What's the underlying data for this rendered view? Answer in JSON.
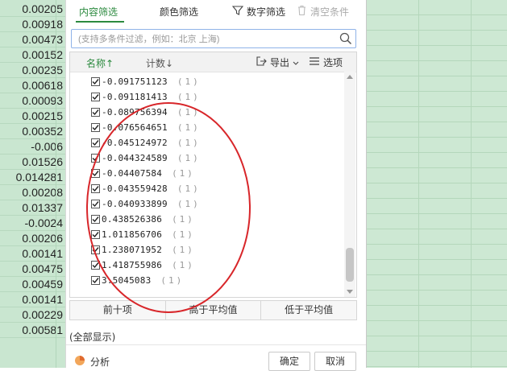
{
  "sheet": {
    "left_cells": [
      "0.00205",
      "0.00918",
      "0.00473",
      "0.00152",
      "0.00235",
      "0.00618",
      "0.00093",
      "0.00215",
      "0.00352",
      "-0.006",
      "0.01526",
      "0.014281",
      "0.00208",
      "0.01337",
      "-0.0024",
      "0.00206",
      "0.00141",
      "0.00475",
      "0.00459",
      "0.00141",
      "0.00229",
      "0.00581"
    ]
  },
  "panel": {
    "tabs": [
      "内容筛选",
      "颜色筛选"
    ],
    "number_filter_label": "数字筛选",
    "clear_label": "清空条件",
    "search_placeholder": "(支持多条件过滤，例如：北京 上海)",
    "header": {
      "sort_name": "名称↑",
      "sort_count": "计数↓",
      "export": "导出",
      "options": "选项"
    },
    "items": [
      {
        "value": "-0.091751123",
        "count": "(1)",
        "checked": true
      },
      {
        "value": "-0.091181413",
        "count": "(1)",
        "checked": true
      },
      {
        "value": "-0.089756394",
        "count": "(1)",
        "checked": true
      },
      {
        "value": "-0.076564651",
        "count": "(1)",
        "checked": true
      },
      {
        "value": "-0.045124972",
        "count": "(1)",
        "checked": true
      },
      {
        "value": "-0.044324589",
        "count": "(1)",
        "checked": true
      },
      {
        "value": "-0.04407584",
        "count": "(1)",
        "checked": true
      },
      {
        "value": "-0.043559428",
        "count": "(1)",
        "checked": true
      },
      {
        "value": "-0.040933899",
        "count": "(1)",
        "checked": true
      },
      {
        "value": "0.438526386",
        "count": "(1)",
        "checked": true
      },
      {
        "value": "1.011856706",
        "count": "(1)",
        "checked": true
      },
      {
        "value": "1.238071952",
        "count": "(1)",
        "checked": true
      },
      {
        "value": "1.418755986",
        "count": "(1)",
        "checked": true
      },
      {
        "value": "3.5045083",
        "count": "(1)",
        "checked": true
      }
    ],
    "quick_filters": [
      "前十项",
      "高于平均值",
      "低于平均值"
    ],
    "show_all": "(全部显示)",
    "analysis": "分析",
    "ok": "确定",
    "cancel": "取消"
  },
  "colors": {
    "accent": "#2c8a3f",
    "annotation": "#d8262a",
    "sheet_bg": "#c9e6d0"
  },
  "icons": [
    "filter-icon",
    "trash-icon",
    "search-icon",
    "export-icon",
    "options-list-icon",
    "pie-chart-icon",
    "checkbox-checked-icon"
  ]
}
